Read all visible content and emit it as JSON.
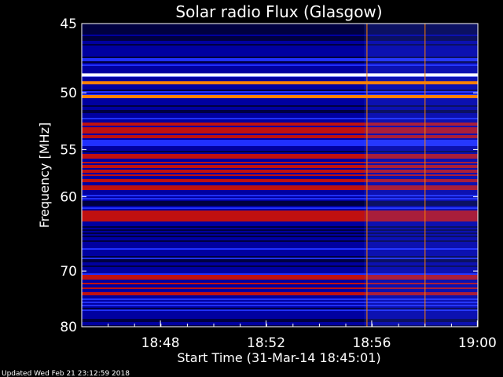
{
  "chart_data": {
    "type": "heatmap",
    "title": "Solar radio Flux (Glasgow)",
    "xlabel": "Start Time (31-Mar-14 18:45:01)",
    "ylabel": "Frequency [MHz]",
    "x_ticks": [
      "18:48",
      "18:52",
      "18:56",
      "19:00"
    ],
    "x_tick_minutes_after_start": [
      2.98,
      6.98,
      10.98,
      14.98
    ],
    "y_ticks": [
      45,
      50,
      55,
      60,
      70,
      80
    ],
    "ylim": [
      45,
      80
    ],
    "y_scale": "reciprocal",
    "colormap": [
      "#000040",
      "#0000a0",
      "#2030ff",
      "#c01010",
      "#ff8000",
      "#ffffc0",
      "#ffffff"
    ],
    "bright_bands_mhz": [
      48.6,
      49.2,
      50.3
    ],
    "intense_bands_mhz": [
      [
        52.5,
        54.0
      ],
      [
        55.5,
        59.5
      ],
      [
        61.5,
        63.0
      ],
      [
        70.5,
        74.5
      ]
    ],
    "bursts_minutes_after_start": [
      10.8,
      13.0
    ]
  },
  "footer": "Updated Wed Feb 21 23:12:59 2018"
}
